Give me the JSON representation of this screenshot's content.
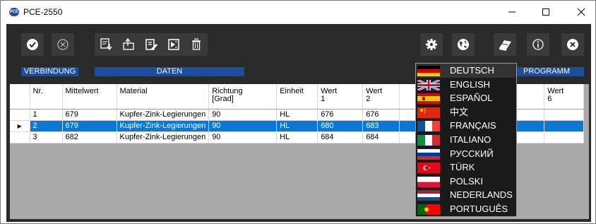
{
  "window": {
    "icon_text": "PCE",
    "title": "PCE-2550"
  },
  "toolbar": {
    "group_labels": {
      "verbindung": "VERBINDUNG",
      "daten": "DATEN",
      "programm": "PROGRAMM"
    },
    "buttons": [
      {
        "name": "connect-button",
        "icon": "check-circle-icon"
      },
      {
        "name": "disconnect-button",
        "icon": "x-circle-icon"
      },
      {
        "name": "import-data-button",
        "icon": "download-document-icon"
      },
      {
        "name": "export-data-button",
        "icon": "upload-folder-icon"
      },
      {
        "name": "edit-data-button",
        "icon": "edit-document-icon"
      },
      {
        "name": "excel-export-button",
        "icon": "excel-icon"
      },
      {
        "name": "delete-button",
        "icon": "trash-icon"
      },
      {
        "name": "settings-button",
        "icon": "gear-icon"
      },
      {
        "name": "language-button",
        "icon": "globe-icon"
      },
      {
        "name": "manual-button",
        "icon": "book-icon"
      },
      {
        "name": "info-button",
        "icon": "info-icon"
      },
      {
        "name": "exit-button",
        "icon": "close-circle-icon"
      }
    ],
    "accent": "#1c4ea0"
  },
  "table": {
    "columns": [
      "",
      "Nr.",
      "Mittelwert",
      "Material",
      "Richtung [Grad]",
      "Einheit",
      "Wert 1",
      "Wert 2",
      "",
      "Wert 5",
      "Wert 6"
    ],
    "header_lines": [
      [
        "",
        ""
      ],
      [
        "Nr.",
        ""
      ],
      [
        "Mittelwert",
        ""
      ],
      [
        "Material",
        ""
      ],
      [
        "Richtung",
        "[Grad]"
      ],
      [
        "Einheit",
        ""
      ],
      [
        "Wert",
        "1"
      ],
      [
        "Wert",
        "2"
      ],
      [
        "",
        ""
      ],
      [
        "",
        "rt"
      ],
      [
        "Wert",
        "6"
      ]
    ],
    "rows": [
      {
        "marker": "",
        "cells": [
          "1",
          "679",
          "Kupfer-Zink-Legierungen",
          "90",
          "HL",
          "676",
          "676",
          "",
          "",
          ""
        ]
      },
      {
        "marker": "▶",
        "cells": [
          "2",
          "679",
          "Kupfer-Zink-Legierungen",
          "90",
          "HL",
          "680",
          "683",
          "",
          "",
          ""
        ],
        "selected": true
      },
      {
        "marker": "",
        "cells": [
          "3",
          "682",
          "Kupfer-Zink-Legierungen",
          "90",
          "HL",
          "684",
          "684",
          "",
          "",
          ""
        ]
      }
    ],
    "selected_color": "#0a78d7"
  },
  "language_menu": {
    "items": [
      {
        "label": "DEUTSCH",
        "flag": "germany-flag-icon"
      },
      {
        "label": "ENGLISH",
        "flag": "uk-flag-icon"
      },
      {
        "label": "ESPAÑOL",
        "flag": "spain-flag-icon"
      },
      {
        "label": "中文",
        "flag": "china-flag-icon"
      },
      {
        "label": "FRANÇAIS",
        "flag": "france-flag-icon"
      },
      {
        "label": "ITALIANO",
        "flag": "italy-flag-icon"
      },
      {
        "label": "РУССКИЙ",
        "flag": "russia-flag-icon"
      },
      {
        "label": "TÜRK",
        "flag": "turkey-flag-icon"
      },
      {
        "label": "POLSKI",
        "flag": "poland-flag-icon"
      },
      {
        "label": "NEDERLANDS",
        "flag": "netherlands-flag-icon"
      },
      {
        "label": "PORTUGUÊS",
        "flag": "portugal-flag-icon"
      }
    ]
  }
}
